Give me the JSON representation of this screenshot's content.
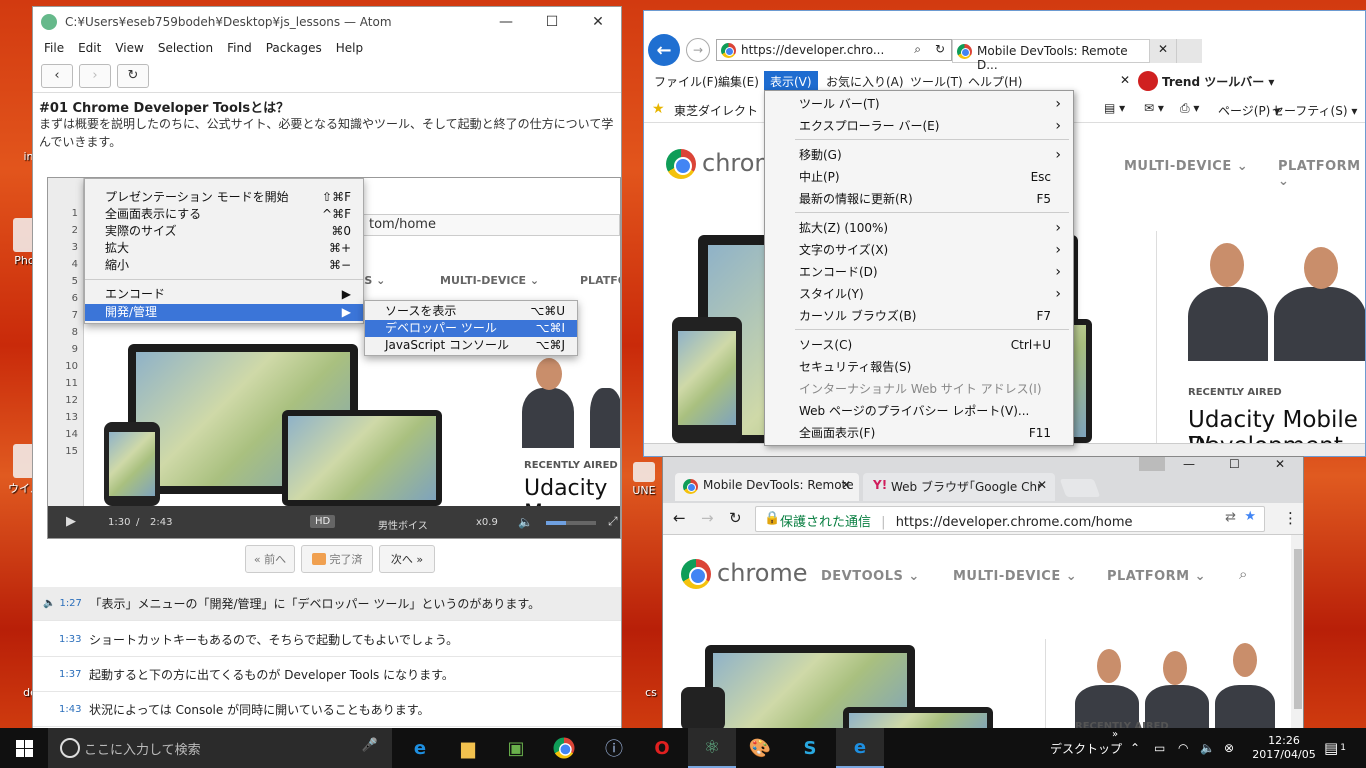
{
  "desktop": {
    "icons": [
      {
        "name": "desktop-icon-1",
        "label": "ind"
      },
      {
        "name": "desktop-icon-2",
        "label": "Photo"
      },
      {
        "name": "desktop-icon-3",
        "label": "ウイルス"
      },
      {
        "name": "desktop-icon-4",
        "label": "de"
      },
      {
        "name": "desktop-icon-5",
        "label": "UNE"
      },
      {
        "name": "desktop-icon-6",
        "label": "cs"
      }
    ]
  },
  "atom": {
    "title": "C:¥Users¥eseb759bodeh¥Desktop¥js_lessons — Atom",
    "menu": [
      "File",
      "Edit",
      "View",
      "Selection",
      "Find",
      "Packages",
      "Help"
    ],
    "lesson_heading": "#01 Chrome Developer Toolsとは？",
    "intro": "まずは概要を説明したのちに、公式サイト、必要となる知識やツール、そして起動と終了の仕方について学んでいきます。",
    "video": {
      "url": "tom/home",
      "line_numbers": [
        "1",
        "2",
        "3",
        "4",
        "5",
        "6",
        "7",
        "8",
        "9",
        "10",
        "11",
        "12",
        "13",
        "14",
        "15"
      ],
      "mac_menu": [
        {
          "label": "プレゼンテーション モードを開始",
          "shortcut": "⇧⌘F"
        },
        {
          "label": "全画面表示にする",
          "shortcut": "^⌘F"
        },
        {
          "label": "実際のサイズ",
          "shortcut": "⌘0"
        },
        {
          "label": "拡大",
          "shortcut": "⌘+"
        },
        {
          "label": "縮小",
          "shortcut": "⌘−"
        },
        {
          "label": "エンコード",
          "shortcut": "▶"
        },
        {
          "label": "開発/管理",
          "shortcut": "▶"
        }
      ],
      "submenu": [
        {
          "label": "ソースを表示",
          "shortcut": "⌥⌘U"
        },
        {
          "label": "デベロッパー ツール",
          "shortcut": "⌥⌘I"
        },
        {
          "label": "JavaScript コンソール",
          "shortcut": "⌥⌘J"
        }
      ],
      "nav_tools": "OLS ⌄",
      "nav_multi": "MULTI-DEVICE ⌄",
      "nav_platform": "PLATFO",
      "recently_aired": "RECENTLY AIRED",
      "udacity": "Udacity M",
      "time_current": "1:30",
      "time_sep": "/",
      "time_total": "2:43",
      "hd": "HD",
      "voice": "男性ボイス",
      "speed": "x0.9",
      "volume_fraction": 0.4
    },
    "pager": {
      "prev": "« 前へ",
      "done": "完了済",
      "next": "次へ »"
    },
    "transcript": [
      {
        "time": "1:27",
        "text": "「表示」メニューの「開発/管理」に「デベロッパー ツール」というのがあります。"
      },
      {
        "time": "1:33",
        "text": "ショートカットキーもあるので、そちらで起動してもよいでしょう。"
      },
      {
        "time": "1:37",
        "text": "起動すると下の方に出てくるものが Developer Tools になります。"
      },
      {
        "time": "1:43",
        "text": "状況によっては Console が同時に開いていることもあります。"
      }
    ]
  },
  "ie": {
    "address": "https://developer.chro...",
    "tab_title": "Mobile DevTools: Remote D...",
    "menu": [
      "ファイル(F)",
      "編集(E)",
      "表示(V)",
      "お気に入り(A)",
      "ツール(T)",
      "ヘルプ(H)"
    ],
    "trend": "Trend ツールバー ▾",
    "fav_item": "東芝ダイレクト",
    "fav_page": "ページ(P) ▾",
    "fav_safety": "セーフティ(S) ▾",
    "page": {
      "logo_text": "chrome",
      "nav_multi": "MULTI-DEVICE ⌄",
      "nav_platform": "PLATFORM ⌄",
      "recently_aired": "RECENTLY AIRED",
      "headline": "Udacity Mobile W",
      "headline2": "Development Co"
    },
    "view_menu": [
      {
        "label": "ツール バー(T)",
        "shortcut": "",
        "sub": true
      },
      {
        "label": "エクスプローラー バー(E)",
        "shortcut": "",
        "sub": true
      },
      {
        "label": "移動(G)",
        "shortcut": "",
        "sub": true
      },
      {
        "label": "中止(P)",
        "shortcut": "Esc"
      },
      {
        "label": "最新の情報に更新(R)",
        "shortcut": "F5"
      },
      {
        "label": "拡大(Z) (100%)",
        "shortcut": "",
        "sub": true
      },
      {
        "label": "文字のサイズ(X)",
        "shortcut": "",
        "sub": true
      },
      {
        "label": "エンコード(D)",
        "shortcut": "",
        "sub": true
      },
      {
        "label": "スタイル(Y)",
        "shortcut": "",
        "sub": true
      },
      {
        "label": "カーソル ブラウズ(B)",
        "shortcut": "F7"
      },
      {
        "label": "ソース(C)",
        "shortcut": "Ctrl+U"
      },
      {
        "label": "セキュリティ報告(S)",
        "shortcut": ""
      },
      {
        "label": "インターナショナル Web サイト アドレス(I)",
        "shortcut": "",
        "disabled": true
      },
      {
        "label": "Web ページのプライバシー レポート(V)...",
        "shortcut": ""
      },
      {
        "label": "全画面表示(F)",
        "shortcut": "F11"
      }
    ]
  },
  "chrome": {
    "tab1": "Mobile DevTools: Remote",
    "tab2": "Web ブラウザ｢Google Chr",
    "secure_label": "保護された通信",
    "url": "https://developer.chrome.com/home",
    "page": {
      "logo_text": "chrome",
      "nav_devtools": "DEVTOOLS ⌄",
      "nav_multi": "MULTI-DEVICE ⌄",
      "nav_platform": "PLATFORM ⌄",
      "recently_aired": "RECENTLY AIRED"
    }
  },
  "taskbar": {
    "search_placeholder": "ここに入力して検索",
    "desktop_label": "デスクトップ",
    "time": "12:26",
    "date": "2017/04/05",
    "notifications": "1"
  }
}
